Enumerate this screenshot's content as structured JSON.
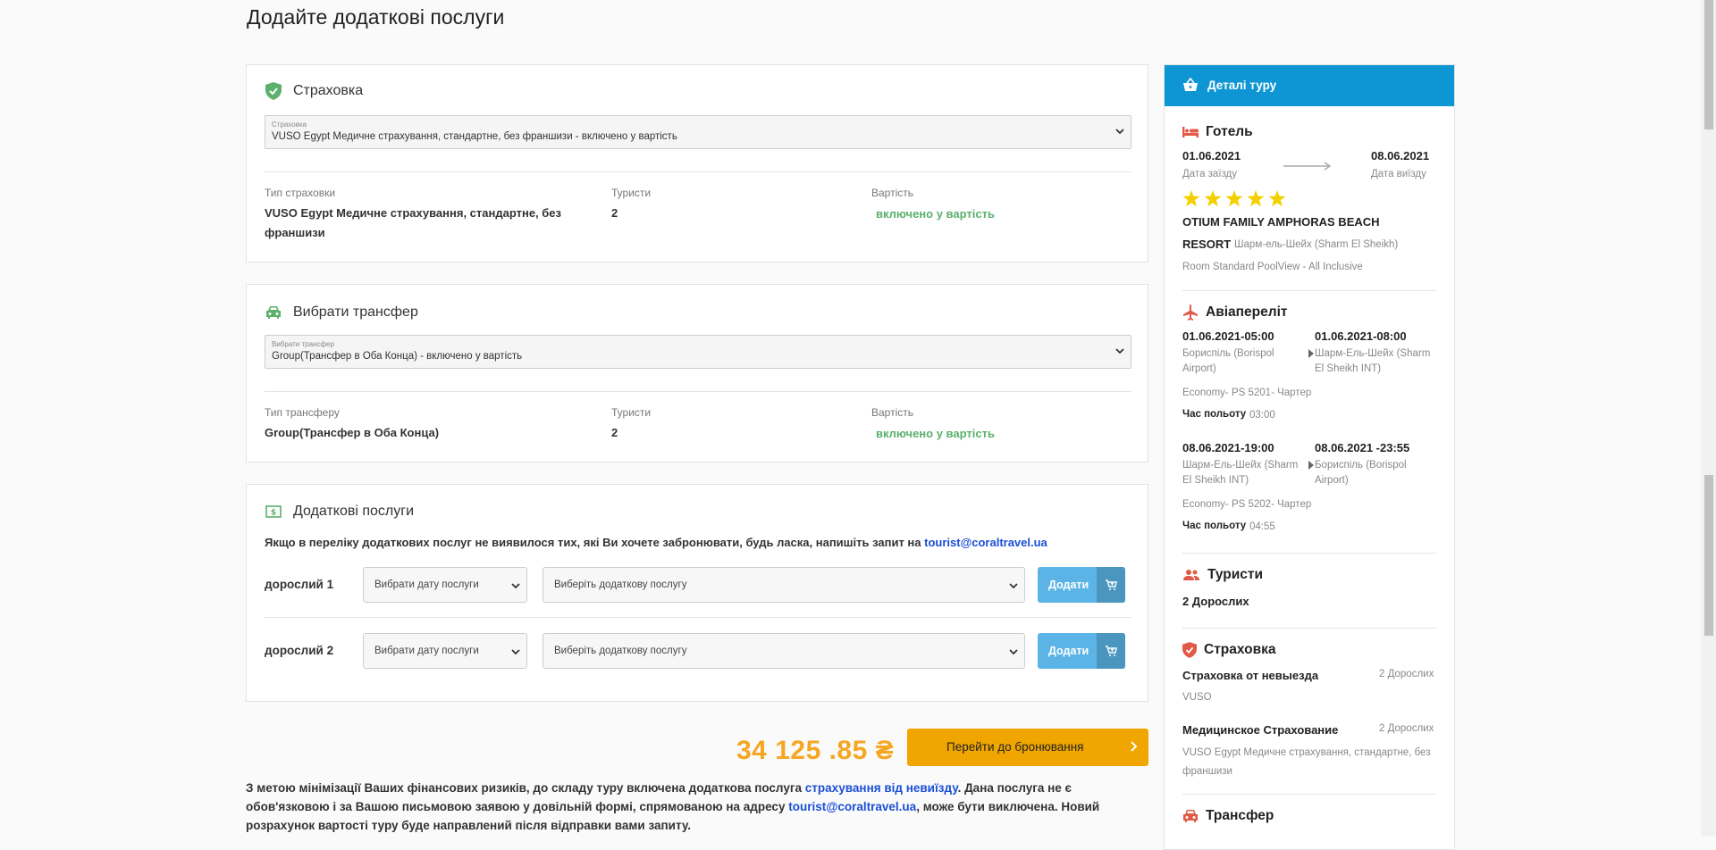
{
  "page": {
    "title": "Додайте додаткові послуги"
  },
  "insurance": {
    "title": "Страховка",
    "select_label": "Страховка",
    "select_value": "VUSO Egypt Медичне страхування, стандартне, без франшизи - включено у вартість",
    "col_type_head": "Тип страховки",
    "col_tourists_head": "Туристи",
    "col_cost_head": "Вартість",
    "type_value": "VUSO Egypt Медичне страхування, стандартне, без франшизи",
    "tourists_value": "2",
    "cost_value": "включено у вартість"
  },
  "transfer": {
    "title": "Вибрати трансфер",
    "select_label": "Вибрати трансфер",
    "select_value": "Group(Трансфер в Оба Конца) - включено у вартість",
    "col_type_head": "Тип трансферу",
    "col_tourists_head": "Туристи",
    "col_cost_head": "Вартість",
    "type_value": "Group(Трансфер в Оба Конца)",
    "tourists_value": "2",
    "cost_value": "включено у вартість"
  },
  "extras": {
    "title": "Додаткові послуги",
    "note_text": "Якщо в переліку додаткових послуг не виявилося тих, які Ви хочете забронювати, будь ласка, напишіть запит на ",
    "note_email": "tourist@coraltravel.ua",
    "rows": [
      {
        "label": "дорослий 1",
        "date_placeholder": "Вибрати дату послуги",
        "service_placeholder": "Виберіть додаткову послугу",
        "add_label": "Додати"
      },
      {
        "label": "дорослий 2",
        "date_placeholder": "Вибрати дату послуги",
        "service_placeholder": "Виберіть додаткову послугу",
        "add_label": "Додати"
      }
    ]
  },
  "total": {
    "price": "34 125 .85 ₴",
    "book_label": "Перейти до бронювання"
  },
  "disclaimer": {
    "part1": "З метою мінімізації Ваших фінансових ризиків, до складу туру включена додаткова послуга ",
    "link1": "страхування від невиїзду",
    "part2": ". Дана послуга не є обов'язковою і за Вашою письмовою заявою у довільній формі, спрямованою на адресу ",
    "link2": "tourist@coraltravel.ua",
    "part3": ", може бути виключена. Новий розрахунок вартості туру буде направлений після відправки вами запиту."
  },
  "side": {
    "header": "Деталі туру",
    "hotel": {
      "title": "Готель",
      "checkin_date": "01.06.2021",
      "checkin_label": "Дата заїзду",
      "checkout_date": "08.06.2021",
      "checkout_label": "Дата виїзду",
      "stars": 5,
      "name_line1": "OTIUM FAMILY AMPHORAS BEACH",
      "name_line2": "RESORT",
      "location": "Шарм-ель-Шейх (Sharm El Sheikh)",
      "room": "Room Standard PoolView - All Inclusive"
    },
    "flight": {
      "title": "Авіапереліт",
      "out_dep_time": "01.06.2021-05:00",
      "out_dep_place": "Бориспіль (Borispol Airport)",
      "out_arr_time": "01.06.2021-08:00",
      "out_arr_place": "Шарм-Ель-Шейх (Sharm El Sheikh INT)",
      "out_class": "Economy- PS 5201- Чартер",
      "duration_label": "Час польоту",
      "out_duration": "03:00",
      "back_dep_time": "08.06.2021-19:00",
      "back_dep_place": "Шарм-Ель-Шейх (Sharm El Sheikh INT)",
      "back_arr_time": "08.06.2021 -23:55",
      "back_arr_place": "Бориспіль (Borispol Airport)",
      "back_class": "Economy- PS 5202- Чартер",
      "back_duration": "04:55"
    },
    "tourists": {
      "title": "Туристи",
      "value": "2 Дорослих"
    },
    "insurance": {
      "title": "Страховка",
      "item1_name": "Страховка от невыезда",
      "item1_count": "2 Дорослих",
      "item1_provider": "VUSO",
      "item2_name": "Медицинское Страхование",
      "item2_count": "2 Дорослих",
      "item2_desc": "VUSO Egypt Медичне страхування, стандартне, без франшизи"
    },
    "transfer": {
      "title": "Трансфер"
    }
  },
  "colors": {
    "accent_blue": "#0e95d3",
    "price_orange": "#f5a623",
    "button_orange": "#f0a500",
    "green": "#5ab06c",
    "icon_red": "#e05a47",
    "star_yellow": "#f5d000"
  }
}
